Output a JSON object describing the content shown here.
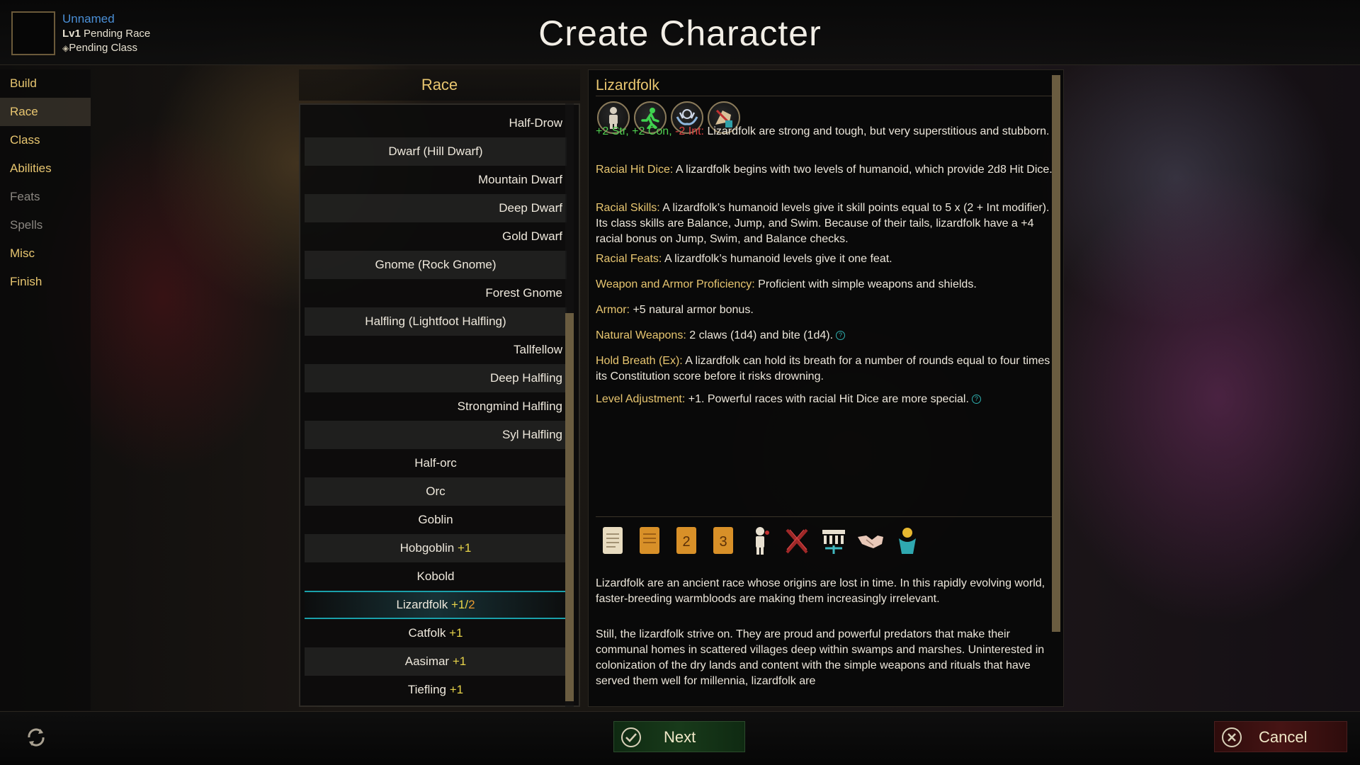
{
  "header": {
    "name": "Unnamed",
    "level_prefix": "Lv1",
    "level_text": "Pending Race",
    "class_text": "Pending Class",
    "title": "Create Character"
  },
  "nav": {
    "items": [
      {
        "label": "Build"
      },
      {
        "label": "Race"
      },
      {
        "label": "Class"
      },
      {
        "label": "Abilities"
      },
      {
        "label": "Feats"
      },
      {
        "label": "Spells"
      },
      {
        "label": "Misc"
      },
      {
        "label": "Finish"
      }
    ]
  },
  "race_panel": {
    "header": "Race",
    "items": [
      {
        "label": "Half-Drow",
        "bonus": "",
        "bonus2": ""
      },
      {
        "label": "Dwarf (Hill Dwarf)",
        "bonus": "",
        "bonus2": ""
      },
      {
        "label": "Mountain Dwarf",
        "bonus": "",
        "bonus2": ""
      },
      {
        "label": "Deep Dwarf",
        "bonus": "",
        "bonus2": ""
      },
      {
        "label": "Gold Dwarf",
        "bonus": "",
        "bonus2": ""
      },
      {
        "label": "Gnome (Rock Gnome)",
        "bonus": "",
        "bonus2": ""
      },
      {
        "label": "Forest Gnome",
        "bonus": "",
        "bonus2": ""
      },
      {
        "label": "Halfling (Lightfoot Halfling)",
        "bonus": "",
        "bonus2": ""
      },
      {
        "label": "Tallfellow",
        "bonus": "",
        "bonus2": ""
      },
      {
        "label": "Deep Halfling",
        "bonus": "",
        "bonus2": ""
      },
      {
        "label": "Strongmind Halfling",
        "bonus": "",
        "bonus2": ""
      },
      {
        "label": "Syl Halfling",
        "bonus": "",
        "bonus2": ""
      },
      {
        "label": "Half-orc",
        "bonus": "",
        "bonus2": ""
      },
      {
        "label": "Orc",
        "bonus": "",
        "bonus2": ""
      },
      {
        "label": "Goblin",
        "bonus": "",
        "bonus2": ""
      },
      {
        "label": "Hobgoblin",
        "bonus": "+1",
        "bonus2": ""
      },
      {
        "label": "Kobold",
        "bonus": "",
        "bonus2": ""
      },
      {
        "label": "Lizardfolk",
        "bonus": "+1/",
        "bonus2": "2"
      },
      {
        "label": "Catfolk",
        "bonus": "+1",
        "bonus2": ""
      },
      {
        "label": "Aasimar",
        "bonus": "+1",
        "bonus2": ""
      },
      {
        "label": "Tiefling",
        "bonus": "+1",
        "bonus2": ""
      }
    ],
    "selected": "Lizardfolk"
  },
  "detail": {
    "title": "Lizardfolk",
    "trait_icons": [
      "humanoid-icon",
      "runner-icon",
      "hands-icon",
      "armored-figure-icon"
    ],
    "stats": {
      "str": "+2 Str,",
      "con": "+2 Con,",
      "int": "-2 Int:",
      "text": "Lizardfolk are strong and tough, but very superstitious and stubborn."
    },
    "hit_dice": {
      "label": "Racial Hit Dice:",
      "text": "A lizardfolk begins with two levels of humanoid, which provide 2d8 Hit Dice."
    },
    "skills": {
      "label": "Racial Skills:",
      "text": "A lizardfolk’s humanoid levels give it skill points equal to 5 x (2 + Int modifier). Its class skills are Balance, Jump, and Swim. Because of their tails, lizardfolk have a +4 racial bonus on Jump, Swim, and Balance checks."
    },
    "feats": {
      "label": "Racial Feats:",
      "text": "A lizardfolk’s humanoid levels give it one feat."
    },
    "proficiency": {
      "label": "Weapon and Armor Proficiency:",
      "text": "Proficient with simple weapons and shields."
    },
    "armor": {
      "label": "Armor:",
      "text": "+5 natural armor bonus."
    },
    "weapons": {
      "label": "Natural Weapons:",
      "text": "2 claws (1d4) and bite (1d4)."
    },
    "breath": {
      "label": "Hold Breath (Ex):",
      "text": "A lizardfolk can hold its breath for a number of rounds equal to four times its Constitution score before it risks drowning."
    },
    "level_adj": {
      "label": "Level Adjustment:",
      "text": "+1. Powerful races with racial Hit Dice are more special."
    },
    "book_icons": [
      {
        "name": "scroll-icon",
        "num": ""
      },
      {
        "name": "book-1-icon",
        "num": ""
      },
      {
        "name": "book-2-icon",
        "num": "2"
      },
      {
        "name": "book-3-icon",
        "num": "3"
      },
      {
        "name": "figure-icon",
        "num": ""
      },
      {
        "name": "crossed-swords-icon",
        "num": ""
      },
      {
        "name": "court-icon",
        "num": ""
      },
      {
        "name": "handshake-icon",
        "num": ""
      },
      {
        "name": "deity-icon",
        "num": ""
      }
    ],
    "lore_1": "Lizardfolk are an ancient race whose origins are lost in time. In this rapidly evolving world, faster-breeding warmbloods are making them increasingly irrelevant.",
    "lore_2": "Still, the lizardfolk strive on. They are proud and powerful predators that make their communal homes in scattered villages deep within swamps and marshes. Uninterested in colonization of the dry lands and content with the simple weapons and rituals that have served them well for millennia, lizardfolk are",
    "help_glyph": "?"
  },
  "footer": {
    "next_label": "Next",
    "cancel_label": "Cancel"
  },
  "colors": {
    "gold_label": "#e8c670",
    "name_blue": "#4a8fd6",
    "bonus_yellow": "#e8d44a",
    "bonus_orange": "#e89a30",
    "stat_green": "#4fcf4f",
    "stat_red": "#e04040",
    "selection_teal": "#1aa0aa"
  }
}
